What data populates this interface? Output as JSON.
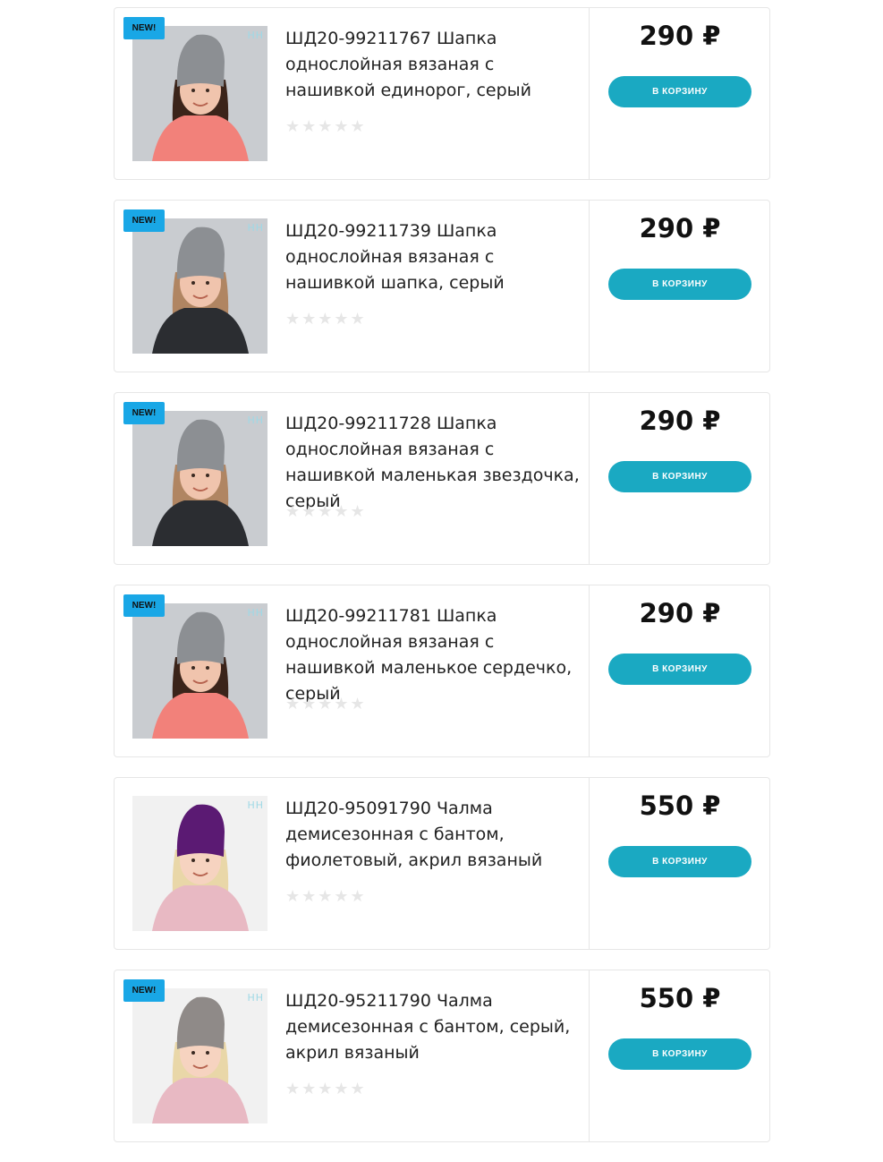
{
  "products": [
    {
      "badge": "NEW!",
      "title": "ШД20-99211767 Шапка однослойная вязаная с нашивкой единорог, серый",
      "rating": "★★★★★",
      "price": "290 ₽",
      "cart_label": "В КОРЗИНУ",
      "photo": {
        "bg": "#c9ccd0",
        "hat": "#8c8f93",
        "hair": "#3b241a",
        "jacket": "#f2817a",
        "skin": "#f0c4ad"
      }
    },
    {
      "badge": "NEW!",
      "title": "ШД20-99211739 Шапка однослойная вязаная с нашивкой шапка, серый",
      "rating": "★★★★★",
      "price": "290 ₽",
      "cart_label": "В КОРЗИНУ",
      "photo": {
        "bg": "#c9ccd0",
        "hat": "#8c8f93",
        "hair": "#b08562",
        "jacket": "#2b2d31",
        "skin": "#f0c4ad"
      }
    },
    {
      "badge": "NEW!",
      "title": "ШД20-99211728 Шапка однослойная вязаная с нашивкой маленькая звездочка, серый",
      "rating": "★★★★★",
      "price": "290 ₽",
      "cart_label": "В КОРЗИНУ",
      "photo": {
        "bg": "#c9ccd0",
        "hat": "#8c8f93",
        "hair": "#b08562",
        "jacket": "#2b2d31",
        "skin": "#f0c4ad"
      }
    },
    {
      "badge": "NEW!",
      "title": "ШД20-99211781 Шапка однослойная вязаная с нашивкой маленькое сердечко, серый",
      "rating": "★★★★★",
      "price": "290 ₽",
      "cart_label": "В КОРЗИНУ",
      "photo": {
        "bg": "#c9ccd0",
        "hat": "#8c8f93",
        "hair": "#3b241a",
        "jacket": "#f2817a",
        "skin": "#f0c4ad"
      }
    },
    {
      "badge": "",
      "title": "ШД20-95091790 Чалма демисезонная с бантом, фиолетовый, акрил вязаный",
      "rating": "★★★★★",
      "price": "550 ₽",
      "cart_label": "В КОРЗИНУ",
      "photo": {
        "bg": "#f1f1f1",
        "hat": "#5b1a73",
        "hair": "#e9d7a8",
        "jacket": "#e8b9c3",
        "skin": "#f6d3c0"
      }
    },
    {
      "badge": "NEW!",
      "title": "ШД20-95211790 Чалма демисезонная с бантом, серый, акрил вязаный",
      "rating": "★★★★★",
      "price": "550 ₽",
      "cart_label": "В КОРЗИНУ",
      "photo": {
        "bg": "#f1f1f1",
        "hat": "#8f8a88",
        "hair": "#e9d7a8",
        "jacket": "#e8b9c3",
        "skin": "#f6d3c0"
      }
    }
  ],
  "brand_mark": "НН"
}
